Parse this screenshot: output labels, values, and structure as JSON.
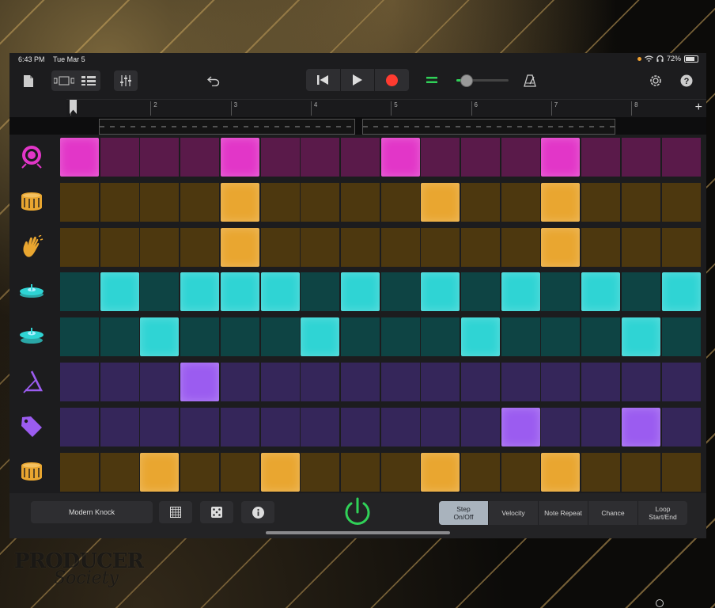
{
  "status": {
    "time": "6:43 PM",
    "date": "Tue Mar 5",
    "battery": "72%"
  },
  "toolbar": {
    "icons": [
      "document-icon",
      "view-toggle-icon",
      "tracks-view-icon",
      "mixer-icon",
      "undo-icon",
      "rewind-icon",
      "play-icon",
      "record-icon",
      "volume-icon",
      "metronome-icon",
      "settings-icon",
      "help-icon"
    ],
    "volume_level": 0.18
  },
  "ruler": {
    "bars": [
      "1",
      "2",
      "3",
      "4",
      "5",
      "6",
      "7",
      "8"
    ],
    "add": "+"
  },
  "grid": {
    "steps": 16,
    "rows": [
      {
        "instrument": "kick",
        "icon": "kick-drum-icon",
        "color_on": "#e236c8",
        "color_off": "#5a1a4a",
        "pattern": [
          1,
          0,
          0,
          0,
          1,
          0,
          0,
          0,
          1,
          0,
          0,
          0,
          1,
          0,
          0,
          0
        ]
      },
      {
        "instrument": "snare",
        "icon": "snare-drum-icon",
        "color_on": "#e9a630",
        "color_off": "#4d380f",
        "pattern": [
          0,
          0,
          0,
          0,
          1,
          0,
          0,
          0,
          0,
          1,
          0,
          0,
          1,
          0,
          0,
          0
        ]
      },
      {
        "instrument": "clap",
        "icon": "clap-hand-icon",
        "color_on": "#e9a630",
        "color_off": "#4d380f",
        "pattern": [
          0,
          0,
          0,
          0,
          1,
          0,
          0,
          0,
          0,
          0,
          0,
          0,
          1,
          0,
          0,
          0
        ]
      },
      {
        "instrument": "closed-hihat",
        "icon": "cymbal-icon",
        "color_on": "#2fd4d4",
        "color_off": "#0e4444",
        "pattern": [
          0,
          1,
          0,
          1,
          1,
          1,
          0,
          1,
          0,
          1,
          0,
          1,
          0,
          1,
          0,
          1
        ]
      },
      {
        "instrument": "open-hihat",
        "icon": "cymbal-open-icon",
        "color_on": "#2fd4d4",
        "color_off": "#0e4444",
        "pattern": [
          0,
          0,
          1,
          0,
          0,
          0,
          1,
          0,
          0,
          0,
          1,
          0,
          0,
          0,
          1,
          0
        ]
      },
      {
        "instrument": "triangle",
        "icon": "triangle-icon",
        "color_on": "#9b5cf0",
        "color_off": "#35265a",
        "pattern": [
          0,
          0,
          0,
          1,
          0,
          0,
          0,
          0,
          0,
          0,
          0,
          0,
          0,
          0,
          0,
          0
        ]
      },
      {
        "instrument": "cowbell",
        "icon": "tag-icon",
        "color_on": "#9b5cf0",
        "color_off": "#35265a",
        "pattern": [
          0,
          0,
          0,
          0,
          0,
          0,
          0,
          0,
          0,
          0,
          0,
          1,
          0,
          0,
          1,
          0
        ]
      },
      {
        "instrument": "tom",
        "icon": "snare-drum-icon",
        "color_on": "#e9a630",
        "color_off": "#4d380f",
        "pattern": [
          0,
          0,
          1,
          0,
          0,
          1,
          0,
          0,
          0,
          1,
          0,
          0,
          1,
          0,
          0,
          0
        ]
      }
    ]
  },
  "bottom": {
    "kit_name": "Modern Knock",
    "modes": [
      {
        "label": "Step\nOn/Off",
        "active": true
      },
      {
        "label": "Velocity",
        "active": false
      },
      {
        "label": "Note Repeat",
        "active": false
      },
      {
        "label": "Chance",
        "active": false
      },
      {
        "label": "Loop\nStart/End",
        "active": false
      }
    ]
  },
  "watermark": {
    "line1": "PRODUCER",
    "line2": "Society"
  }
}
